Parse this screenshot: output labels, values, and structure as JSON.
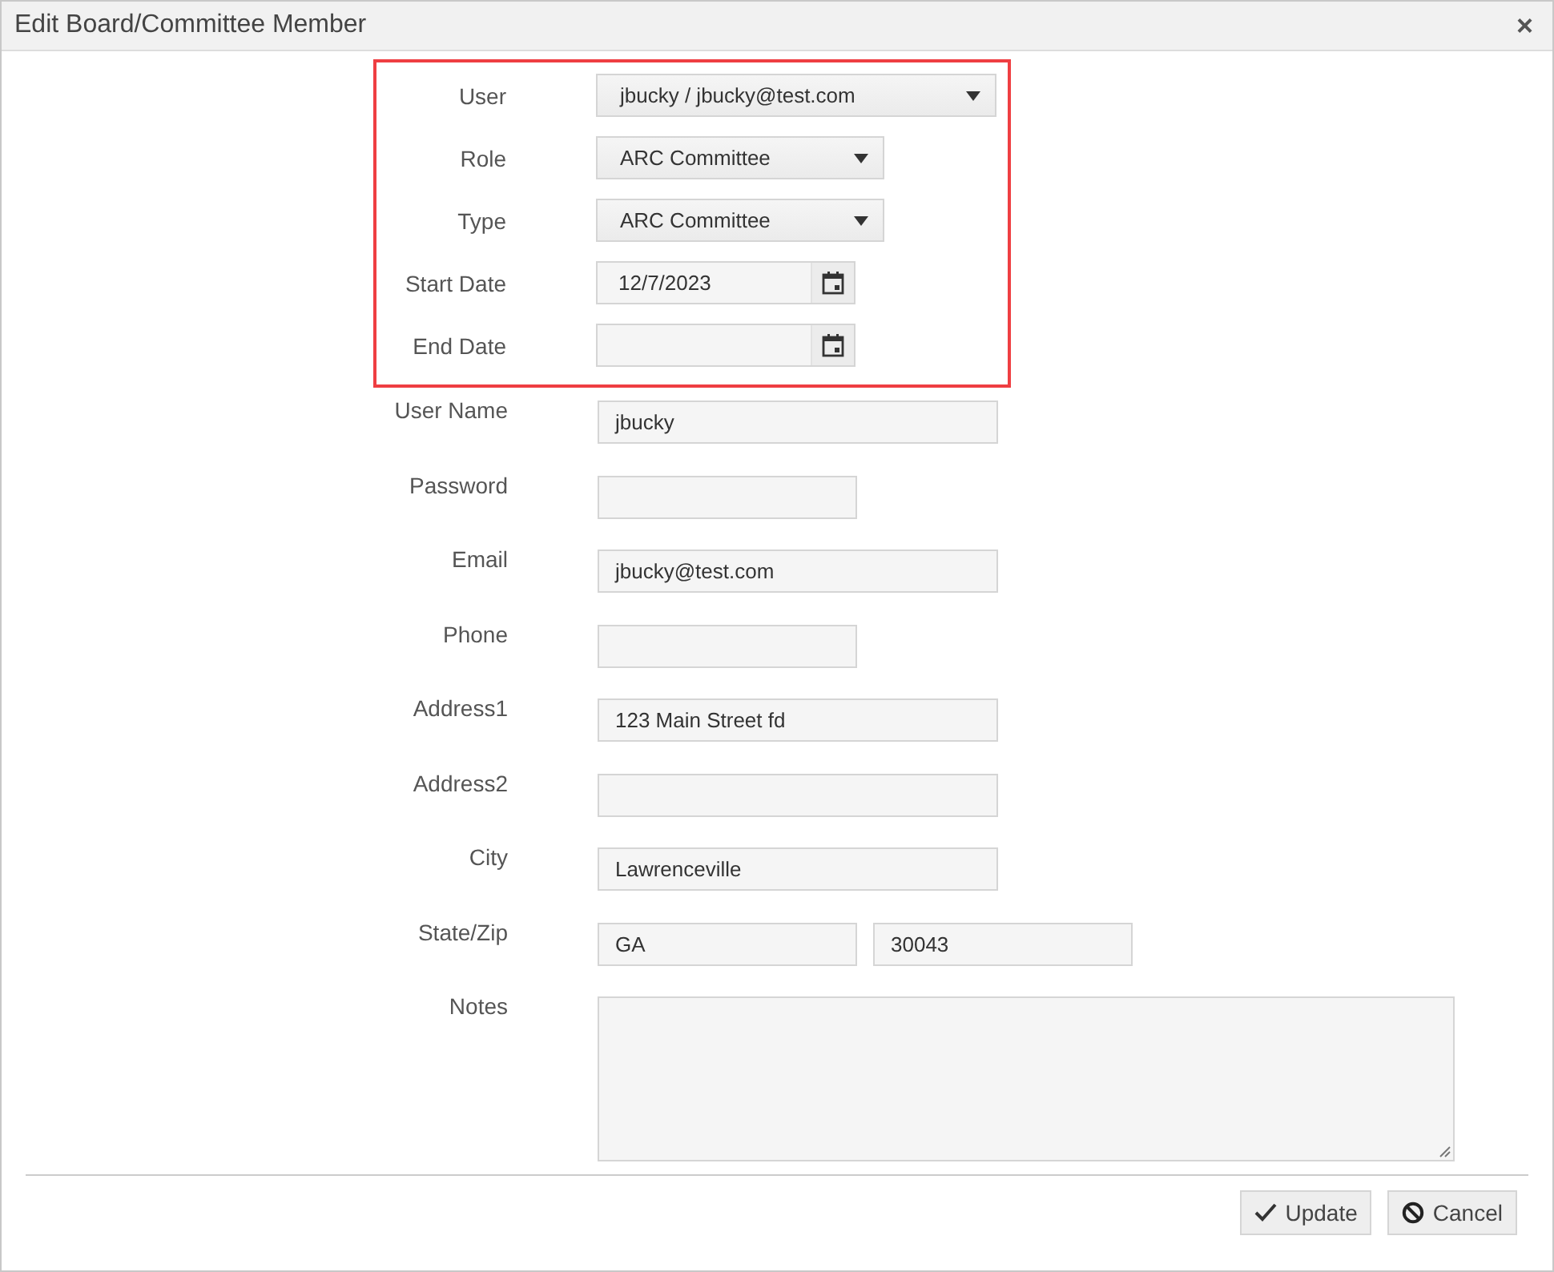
{
  "dialog": {
    "title": "Edit Board/Committee Member",
    "close": "×"
  },
  "highlighted_fields": [
    {
      "kind": "select-long",
      "label": "User",
      "value": "jbucky / jbucky@test.com"
    },
    {
      "kind": "select-short",
      "label": "Role",
      "value": "ARC Committee"
    },
    {
      "kind": "select-short",
      "label": "Type",
      "value": "ARC Committee"
    },
    {
      "kind": "date",
      "label": "Start Date",
      "value": "12/7/2023"
    },
    {
      "kind": "date",
      "label": "End Date"
    }
  ],
  "fields": [
    {
      "kind": "text-long",
      "label": "User Name",
      "value": "jbucky"
    },
    {
      "kind": "text-short",
      "label": "Password"
    },
    {
      "kind": "text-long",
      "label": "Email",
      "value": "jbucky@test.com"
    },
    {
      "kind": "text-short",
      "label": "Phone"
    },
    {
      "kind": "text-long",
      "label": "Address1",
      "value": "123 Main Street fd"
    },
    {
      "kind": "text-long",
      "label": "Address2"
    },
    {
      "kind": "text-long",
      "label": "City",
      "value": "Lawrenceville"
    },
    {
      "kind": "pair",
      "label": "State/Zip",
      "value": "GA",
      "value_2": "30043"
    },
    {
      "kind": "textarea",
      "label": "Notes"
    }
  ],
  "buttons": [
    {
      "kind": "update",
      "label": "Update"
    },
    {
      "kind": "cancel",
      "label": "Cancel"
    }
  ]
}
